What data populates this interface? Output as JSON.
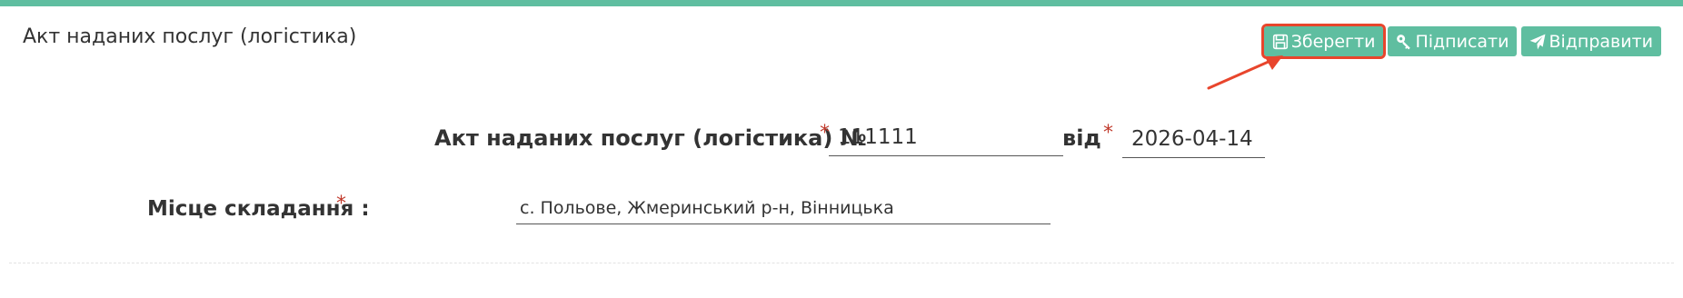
{
  "header": {
    "title": "Акт наданих послуг (логістика)"
  },
  "toolbar": {
    "save_label": "Зберегти",
    "sign_label": "Підписати",
    "send_label": "Відправити"
  },
  "document": {
    "number_label": "Акт наданих послуг (логістика) №",
    "number_value": "111111",
    "date_label": "від",
    "date_value": "2026-04-14",
    "required_mark": "*"
  },
  "place": {
    "label": "Місце складання :",
    "value": "с. Польове, Жмеринський р-н, Вінницька"
  },
  "colors": {
    "accent": "#5fbea0",
    "highlight": "#e8452c",
    "required": "#c0392b"
  },
  "icons": {
    "save": "floppy-disk-icon",
    "sign": "key-icon",
    "send": "paper-plane-icon"
  }
}
